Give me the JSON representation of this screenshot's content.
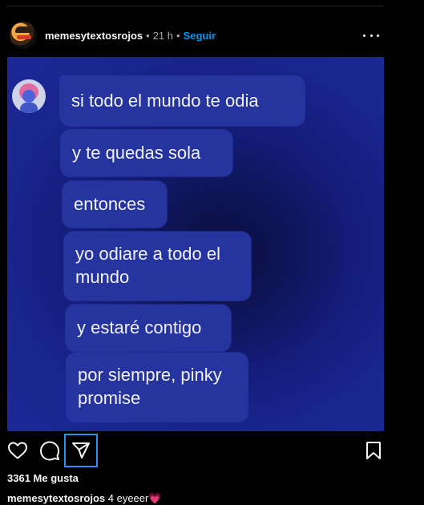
{
  "post": {
    "username": "memesytextosrojos",
    "separator": "•",
    "time": "21 h",
    "follow_label": "Seguir"
  },
  "messages": [
    "si todo el mundo te odia",
    "y te quedas sola",
    "entonces",
    "yo odiare a todo el mundo",
    "y estaré contigo",
    "por siempre, pinky promise"
  ],
  "actions": {
    "like_icon": "heart-icon",
    "comment_icon": "comment-icon",
    "share_icon": "send-icon",
    "save_icon": "bookmark-icon"
  },
  "likes_text": "3361 Me gusta",
  "caption": {
    "username": "memesytextosrojos",
    "text": "4 eyeeer",
    "emoji": "💗"
  },
  "colors": {
    "background": "#000000",
    "accent": "#0095f6",
    "bubble": "#26349f",
    "media_bg": "#1a258f"
  }
}
